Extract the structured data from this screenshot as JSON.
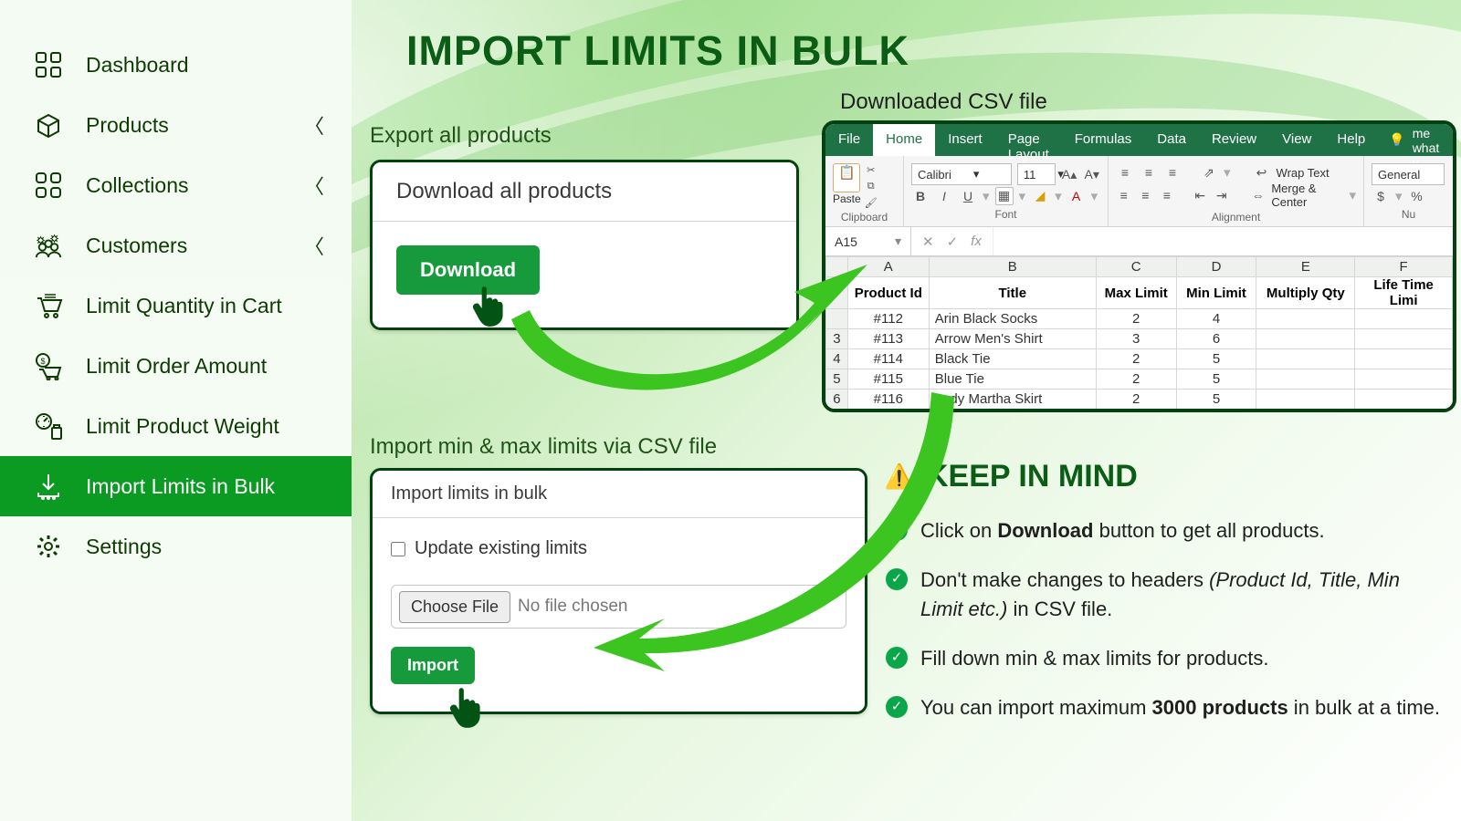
{
  "page_title": "IMPORT LIMITS IN BULK",
  "sidebar": {
    "items": [
      {
        "icon": "dashboard",
        "label": "Dashboard",
        "expandable": false
      },
      {
        "icon": "products",
        "label": "Products",
        "expandable": true
      },
      {
        "icon": "collections",
        "label": "Collections",
        "expandable": true
      },
      {
        "icon": "customers",
        "label": "Customers",
        "expandable": true
      },
      {
        "icon": "cart",
        "label": "Limit Quantity in Cart",
        "expandable": false
      },
      {
        "icon": "amount",
        "label": "Limit Order Amount",
        "expandable": false
      },
      {
        "icon": "weight",
        "label": "Limit Product Weight",
        "expandable": false
      },
      {
        "icon": "import",
        "label": "Import Limits in Bulk",
        "expandable": false,
        "active": true
      },
      {
        "icon": "settings",
        "label": "Settings",
        "expandable": false
      }
    ]
  },
  "export": {
    "section_label": "Export all products",
    "card_title": "Download all products",
    "button": "Download"
  },
  "import": {
    "section_label": "Import min & max limits via CSV file",
    "card_title": "Import limits in bulk",
    "checkbox_label": "Update existing limits",
    "choose_file": "Choose File",
    "no_file": "No file chosen",
    "button": "Import"
  },
  "excel": {
    "label": "Downloaded CSV file",
    "tabs": [
      "File",
      "Home",
      "Insert",
      "Page Layout",
      "Formulas",
      "Data",
      "Review",
      "View",
      "Help"
    ],
    "active_tab": "Home",
    "tell_me": "Tell me what y",
    "font_name": "Calibri",
    "font_size": "11",
    "wrap": "Wrap Text",
    "merge": "Merge & Center",
    "format": "General",
    "groups": [
      "Clipboard",
      "Font",
      "Alignment",
      "Nu"
    ],
    "paste": "Paste",
    "cell_ref": "A15",
    "columns": [
      "A",
      "B",
      "C",
      "D",
      "E",
      "F"
    ],
    "headers": [
      "Product Id",
      "Title",
      "Max Limit",
      "Min Limit",
      "Multiply Qty",
      "Life Time Limi"
    ],
    "rows": [
      {
        "n": "",
        "id": "#112",
        "title": "Arin Black Socks",
        "max": "2",
        "min": "4",
        "mq": "",
        "lt": ""
      },
      {
        "n": "3",
        "id": "#113",
        "title": "Arrow Men's Shirt",
        "max": "3",
        "min": "6",
        "mq": "",
        "lt": ""
      },
      {
        "n": "4",
        "id": "#114",
        "title": "Black Tie",
        "max": "2",
        "min": "5",
        "mq": "",
        "lt": ""
      },
      {
        "n": "5",
        "id": "#115",
        "title": "Blue Tie",
        "max": "2",
        "min": "5",
        "mq": "",
        "lt": ""
      },
      {
        "n": "6",
        "id": "#116",
        "title": "Lady Martha Skirt",
        "max": "2",
        "min": "5",
        "mq": "",
        "lt": ""
      }
    ]
  },
  "keep_in_mind": {
    "title": "KEEP IN MIND",
    "items": [
      {
        "pre": "Click on ",
        "b": "Download",
        "post": " button to get all products."
      },
      {
        "pre": "Don't make changes to headers ",
        "i": "(Product Id, Title, Min Limit etc.)",
        "post": " in CSV file."
      },
      {
        "pre": "Fill down min & max limits for products.",
        "b": "",
        "post": ""
      },
      {
        "pre": "You can import maximum ",
        "b": "3000 products",
        "post": " in bulk at a time."
      }
    ]
  }
}
